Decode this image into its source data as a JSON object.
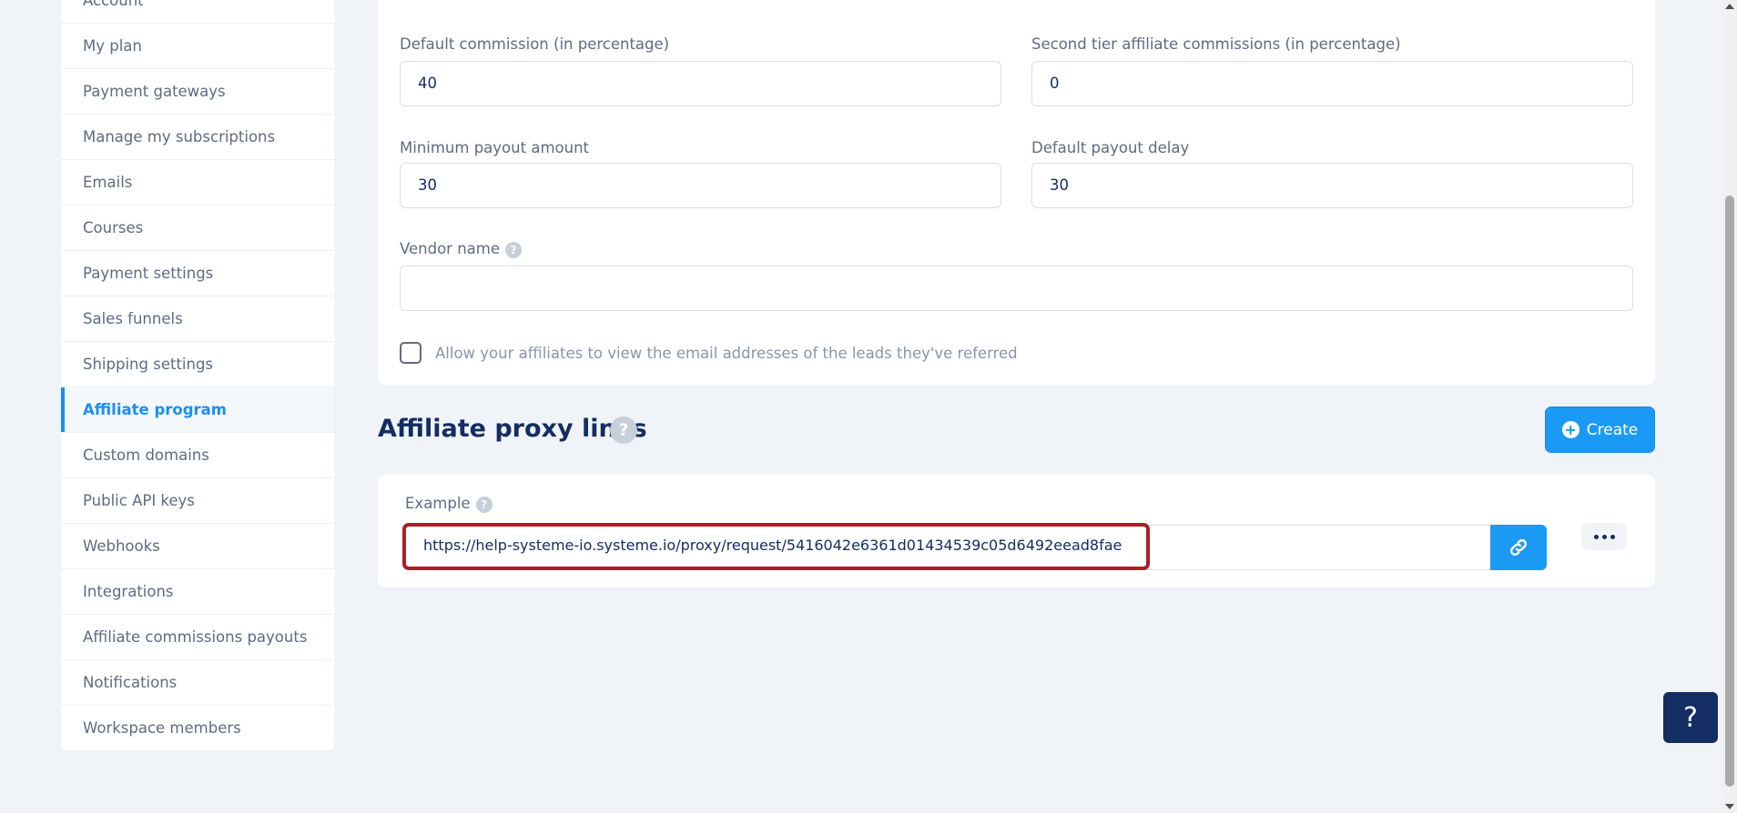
{
  "sidebar": {
    "items": [
      {
        "label": "Account",
        "active": false
      },
      {
        "label": "My plan",
        "active": false
      },
      {
        "label": "Payment gateways",
        "active": false
      },
      {
        "label": "Manage my subscriptions",
        "active": false
      },
      {
        "label": "Emails",
        "active": false
      },
      {
        "label": "Courses",
        "active": false
      },
      {
        "label": "Payment settings",
        "active": false
      },
      {
        "label": "Sales funnels",
        "active": false
      },
      {
        "label": "Shipping settings",
        "active": false
      },
      {
        "label": "Affiliate program",
        "active": true
      },
      {
        "label": "Custom domains",
        "active": false
      },
      {
        "label": "Public API keys",
        "active": false
      },
      {
        "label": "Webhooks",
        "active": false
      },
      {
        "label": "Integrations",
        "active": false
      },
      {
        "label": "Affiliate commissions payouts",
        "active": false
      },
      {
        "label": "Notifications",
        "active": false
      },
      {
        "label": "Workspace members",
        "active": false
      }
    ]
  },
  "settings": {
    "default_commission": {
      "label": "Default commission (in percentage)",
      "value": "40"
    },
    "second_tier": {
      "label": "Second tier affiliate commissions (in percentage)",
      "value": "0"
    },
    "min_payout": {
      "label": "Minimum payout amount",
      "value": "30"
    },
    "payout_delay": {
      "label": "Default payout delay",
      "value": "30"
    },
    "vendor_name": {
      "label": "Vendor name",
      "value": ""
    },
    "allow_emails": {
      "label": "Allow your affiliates to view the email addresses of the leads they've referred",
      "checked": false
    }
  },
  "proxy": {
    "title": "Affiliate proxy links",
    "create_label": "Create",
    "example_label": "Example",
    "example_url": "https://help-systeme-io.systeme.io/proxy/request/5416042e6361d01434539c05d6492eead8fae"
  },
  "help_fab_label": "?",
  "colors": {
    "accent": "#1b9af5",
    "navy": "#142d63",
    "highlight": "#b01d26"
  }
}
